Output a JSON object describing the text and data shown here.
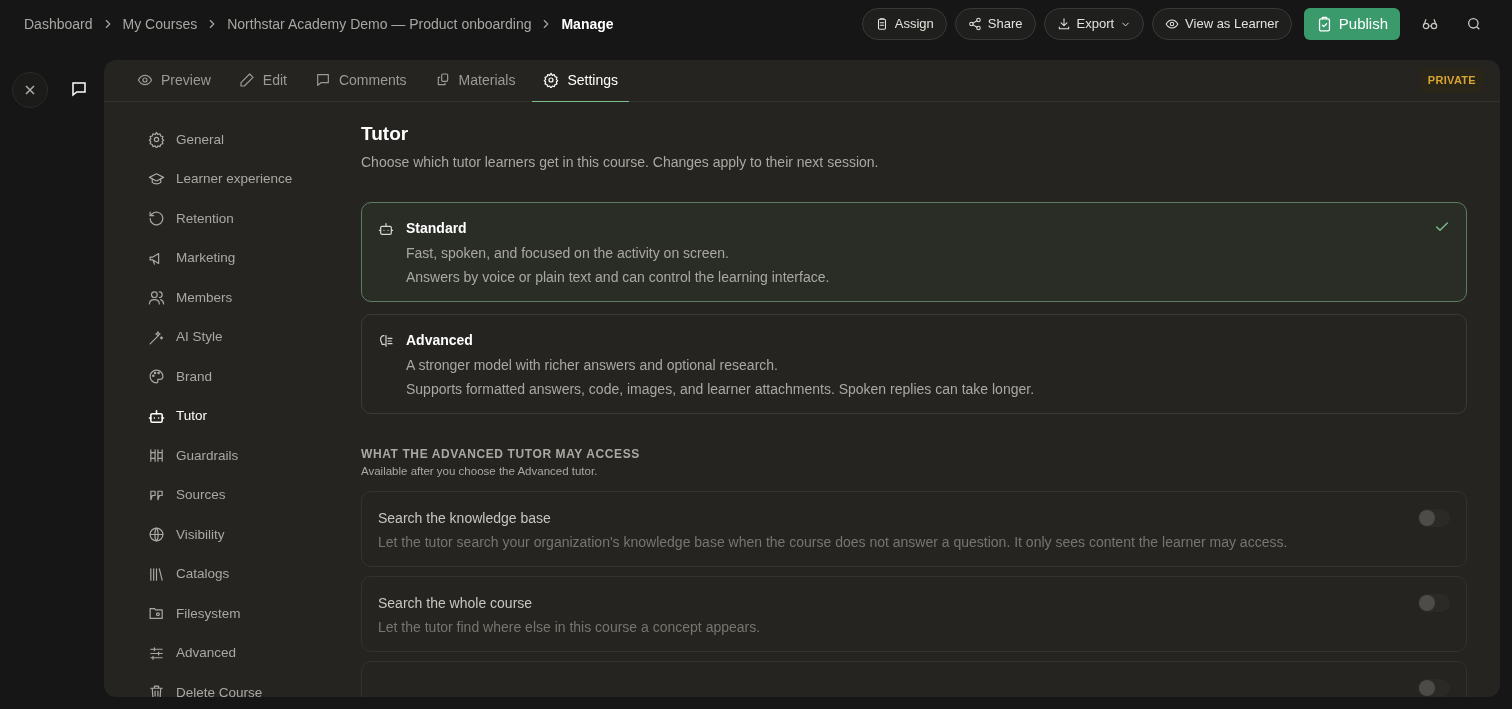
{
  "breadcrumbs": [
    {
      "label": "Dashboard",
      "current": false
    },
    {
      "label": "My Courses",
      "current": false
    },
    {
      "label": "Northstar Academy Demo — Product onboarding",
      "current": false
    },
    {
      "label": "Manage",
      "current": true
    }
  ],
  "actions": [
    {
      "label": "Assign",
      "kind": "outline"
    },
    {
      "label": "Share",
      "kind": "outline"
    },
    {
      "label": "Export",
      "kind": "dropdown"
    },
    {
      "label": "View as Learner",
      "kind": "outline"
    },
    {
      "label": "Publish",
      "kind": "primary"
    }
  ],
  "tabs": [
    {
      "label": "Preview",
      "selected": false
    },
    {
      "label": "Edit",
      "selected": false
    },
    {
      "label": "Comments",
      "selected": false
    },
    {
      "label": "Materials",
      "selected": false
    },
    {
      "label": "Settings",
      "selected": true
    }
  ],
  "visibility_badge": "PRIVATE",
  "sidebar": {
    "items": [
      {
        "label": "General",
        "selected": false
      },
      {
        "label": "Learner experience",
        "selected": false
      },
      {
        "label": "Retention",
        "selected": false
      },
      {
        "label": "Marketing",
        "selected": false
      },
      {
        "label": "Members",
        "selected": false
      },
      {
        "label": "AI Style",
        "selected": false
      },
      {
        "label": "Brand",
        "selected": false
      },
      {
        "label": "Tutor",
        "selected": true
      },
      {
        "label": "Guardrails",
        "selected": false
      },
      {
        "label": "Sources",
        "selected": false
      },
      {
        "label": "Visibility",
        "selected": false
      },
      {
        "label": "Catalogs",
        "selected": false
      },
      {
        "label": "Filesystem",
        "selected": false
      },
      {
        "label": "Advanced",
        "selected": false
      },
      {
        "label": "Delete Course",
        "selected": false
      }
    ]
  },
  "section": {
    "title": "Tutor",
    "description": "Choose which tutor learners get in this course. Changes apply to their next session."
  },
  "tutor_options": [
    {
      "title": "Standard",
      "lines": [
        "Fast, spoken, and focused on the activity on screen.",
        "Answers by voice or plain text and can control the learning interface."
      ],
      "selected": true
    },
    {
      "title": "Advanced",
      "lines": [
        "A stronger model with richer answers and optional research.",
        "Supports formatted answers, code, images, and learner attachments. Spoken replies can take longer."
      ],
      "selected": false
    }
  ],
  "access": {
    "heading": "WHAT THE ADVANCED TUTOR MAY ACCESS",
    "note": "Available after you choose the Advanced tutor.",
    "items": [
      {
        "title": "Search the knowledge base",
        "description": "Let the tutor search your organization's knowledge base when the course does not answer a question. It only sees content the learner may access.",
        "on": false,
        "disabled": true
      },
      {
        "title": "Search the whole course",
        "description": "Let the tutor find where else in this course a concept appears.",
        "on": false,
        "disabled": true
      },
      {
        "on": false,
        "disabled": true
      }
    ]
  }
}
